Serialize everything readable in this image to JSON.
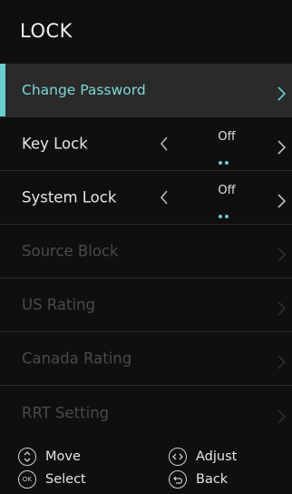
{
  "header": {
    "title": "LOCK"
  },
  "menu": {
    "items": [
      {
        "label": "Change Password"
      },
      {
        "label": "Key Lock",
        "value": "Off"
      },
      {
        "label": "System Lock",
        "value": "Off"
      },
      {
        "label": "Source Block"
      },
      {
        "label": "US Rating"
      },
      {
        "label": "Canada Rating"
      },
      {
        "label": "RRT Setting"
      }
    ]
  },
  "footer": {
    "move": "Move",
    "adjust": "Adjust",
    "select": "Select",
    "back": "Back",
    "ok_icon_text": "OK"
  },
  "colors": {
    "accent": "#6ad0cf",
    "background": "#0f0f0f",
    "selected_row": "#2a2a2a",
    "disabled_text": "#4a4a4a"
  }
}
